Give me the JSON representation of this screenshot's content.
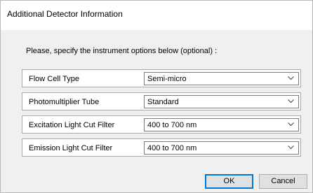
{
  "dialog": {
    "title": "Additional Detector Information",
    "prompt": "Please, specify the instrument options below (optional) :"
  },
  "options": [
    {
      "label": "Flow Cell Type",
      "value": "Semi-micro",
      "icon": "chevron-down-icon"
    },
    {
      "label": "Photomultiplier Tube",
      "value": "Standard",
      "icon": "chevron-down-icon"
    },
    {
      "label": "Excitation Light Cut Filter",
      "value": "400 to 700 nm",
      "icon": "chevron-down-icon"
    },
    {
      "label": "Emission Light Cut Filter",
      "value": "400 to 700 nm",
      "icon": "chevron-down-icon"
    }
  ],
  "buttons": {
    "ok_label": "OK",
    "cancel_label": "Cancel"
  },
  "colors": {
    "accent": "#0078d7",
    "dialog_bg": "#f0f0f0"
  }
}
